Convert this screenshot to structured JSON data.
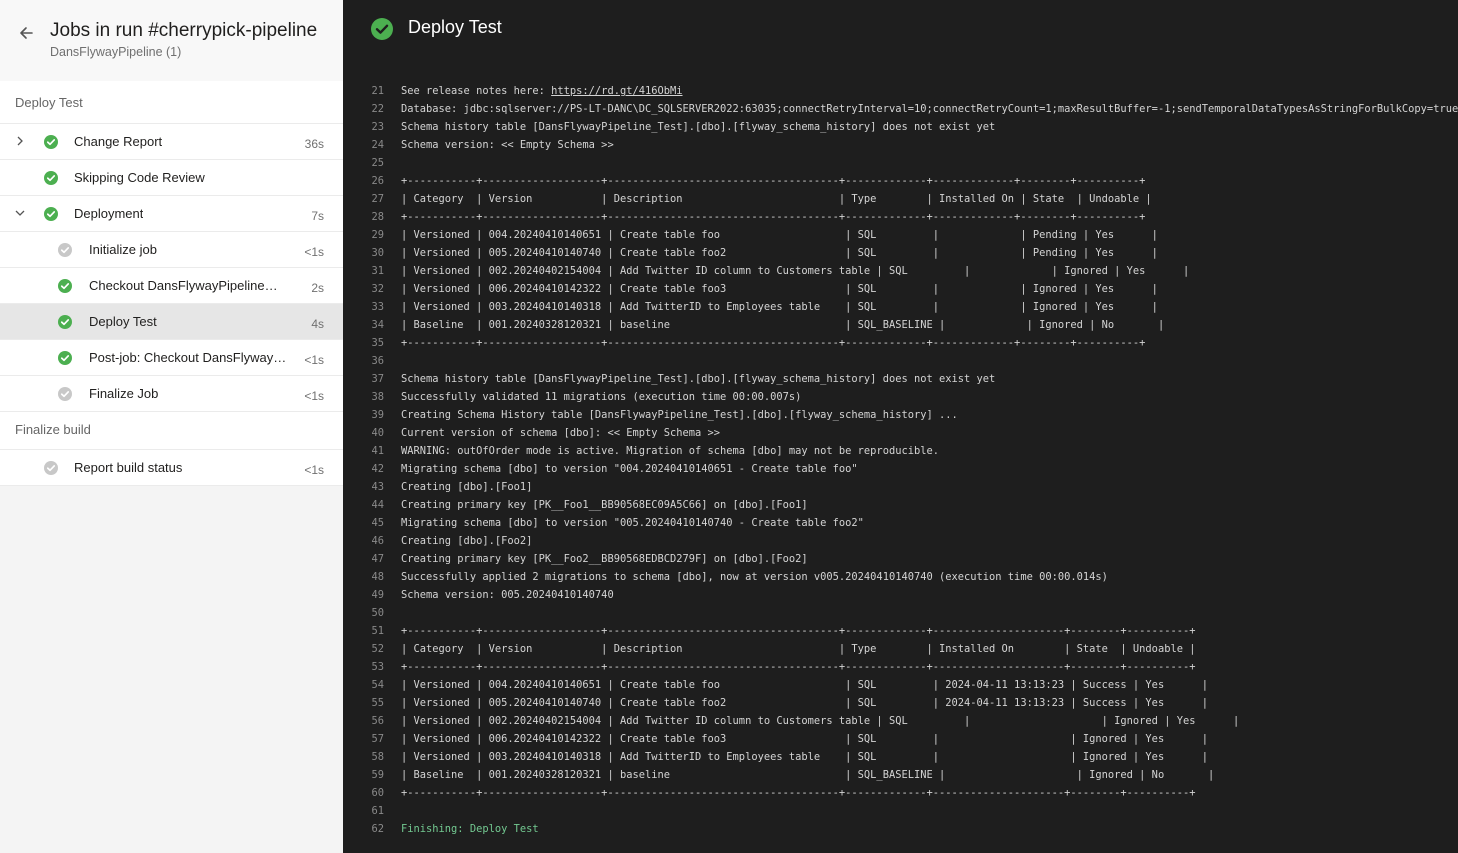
{
  "header": {
    "title": "Jobs in run #cherrypick-pipeline",
    "subtitle": "DansFlywayPipeline (1)"
  },
  "sections": [
    {
      "label": "Deploy Test"
    },
    {
      "label": "Finalize build"
    }
  ],
  "jobs": [
    {
      "label": "Change Report",
      "time": "36s"
    },
    {
      "label": "Skipping Code Review",
      "time": ""
    },
    {
      "label": "Deployment",
      "time": "7s"
    },
    {
      "label": "Initialize job",
      "time": "<1s"
    },
    {
      "label": "Checkout DansFlywayPipeline@main to s",
      "time": "2s"
    },
    {
      "label": "Deploy Test",
      "time": "4s"
    },
    {
      "label": "Post-job: Checkout DansFlywayPipeline@main to s",
      "time": "<1s"
    },
    {
      "label": "Finalize Job",
      "time": "<1s"
    },
    {
      "label": "Report build status",
      "time": "<1s"
    }
  ],
  "main": {
    "title": "Deploy Test",
    "link_text": "https://rd.gt/416ObMi",
    "lines": [
      {
        "n": "21",
        "t": "See release notes here: "
      },
      {
        "n": "22",
        "t": "Database: jdbc:sqlserver://PS-LT-DANC\\DC_SQLSERVER2022:63035;connectRetryInterval=10;connectRetryCount=1;maxResultBuffer=-1;sendTemporalDataTypesAsStringForBulkCopy=true;delayLoadingLobs=true;"
      },
      {
        "n": "23",
        "t": "Schema history table [DansFlywayPipeline_Test].[dbo].[flyway_schema_history] does not exist yet"
      },
      {
        "n": "24",
        "t": "Schema version: << Empty Schema >>"
      },
      {
        "n": "25",
        "t": ""
      },
      {
        "n": "26",
        "t": "+-----------+-------------------+-------------------------------------+-------------+-------------+--------+----------+"
      },
      {
        "n": "27",
        "t": "| Category  | Version           | Description                         | Type        | Installed On | State  | Undoable |"
      },
      {
        "n": "28",
        "t": "+-----------+-------------------+-------------------------------------+-------------+-------------+--------+----------+"
      },
      {
        "n": "29",
        "t": "| Versioned | 004.20240410140651 | Create table foo                    | SQL         |             | Pending | Yes      |"
      },
      {
        "n": "30",
        "t": "| Versioned | 005.20240410140740 | Create table foo2                   | SQL         |             | Pending | Yes      |"
      },
      {
        "n": "31",
        "t": "| Versioned | 002.20240402154004 | Add Twitter ID column to Customers table | SQL         |             | Ignored | Yes      |"
      },
      {
        "n": "32",
        "t": "| Versioned | 006.20240410142322 | Create table foo3                   | SQL         |             | Ignored | Yes      |"
      },
      {
        "n": "33",
        "t": "| Versioned | 003.20240410140318 | Add TwitterID to Employees table    | SQL         |             | Ignored | Yes      |"
      },
      {
        "n": "34",
        "t": "| Baseline  | 001.20240328120321 | baseline                            | SQL_BASELINE |             | Ignored | No       |"
      },
      {
        "n": "35",
        "t": "+-----------+-------------------+-------------------------------------+-------------+-------------+--------+----------+"
      },
      {
        "n": "36",
        "t": ""
      },
      {
        "n": "37",
        "t": "Schema history table [DansFlywayPipeline_Test].[dbo].[flyway_schema_history] does not exist yet"
      },
      {
        "n": "38",
        "t": "Successfully validated 11 migrations (execution time 00:00.007s)"
      },
      {
        "n": "39",
        "t": "Creating Schema History table [DansFlywayPipeline_Test].[dbo].[flyway_schema_history] ..."
      },
      {
        "n": "40",
        "t": "Current version of schema [dbo]: << Empty Schema >>"
      },
      {
        "n": "41",
        "t": "WARNING: outOfOrder mode is active. Migration of schema [dbo] may not be reproducible."
      },
      {
        "n": "42",
        "t": "Migrating schema [dbo] to version \"004.20240410140651 - Create table foo\""
      },
      {
        "n": "43",
        "t": "Creating [dbo].[Foo1]"
      },
      {
        "n": "44",
        "t": "Creating primary key [PK__Foo1__BB90568EC09A5C66] on [dbo].[Foo1]"
      },
      {
        "n": "45",
        "t": "Migrating schema [dbo] to version \"005.20240410140740 - Create table foo2\""
      },
      {
        "n": "46",
        "t": "Creating [dbo].[Foo2]"
      },
      {
        "n": "47",
        "t": "Creating primary key [PK__Foo2__BB90568EDBCD279F] on [dbo].[Foo2]"
      },
      {
        "n": "48",
        "t": "Successfully applied 2 migrations to schema [dbo], now at version v005.20240410140740 (execution time 00:00.014s)"
      },
      {
        "n": "49",
        "t": "Schema version: 005.20240410140740"
      },
      {
        "n": "50",
        "t": ""
      },
      {
        "n": "51",
        "t": "+-----------+-------------------+-------------------------------------+-------------+---------------------+--------+----------+"
      },
      {
        "n": "52",
        "t": "| Category  | Version           | Description                         | Type        | Installed On        | State  | Undoable |"
      },
      {
        "n": "53",
        "t": "+-----------+-------------------+-------------------------------------+-------------+---------------------+--------+----------+"
      },
      {
        "n": "54",
        "t": "| Versioned | 004.20240410140651 | Create table foo                    | SQL         | 2024-04-11 13:13:23 | Success | Yes      |"
      },
      {
        "n": "55",
        "t": "| Versioned | 005.20240410140740 | Create table foo2                   | SQL         | 2024-04-11 13:13:23 | Success | Yes      |"
      },
      {
        "n": "56",
        "t": "| Versioned | 002.20240402154004 | Add Twitter ID column to Customers table | SQL         |                     | Ignored | Yes      |"
      },
      {
        "n": "57",
        "t": "| Versioned | 006.20240410142322 | Create table foo3                   | SQL         |                     | Ignored | Yes      |"
      },
      {
        "n": "58",
        "t": "| Versioned | 003.20240410140318 | Add TwitterID to Employees table    | SQL         |                     | Ignored | Yes      |"
      },
      {
        "n": "59",
        "t": "| Baseline  | 001.20240328120321 | baseline                            | SQL_BASELINE |                     | Ignored | No       |"
      },
      {
        "n": "60",
        "t": "+-----------+-------------------+-------------------------------------+-------------+---------------------+--------+----------+"
      },
      {
        "n": "61",
        "t": ""
      },
      {
        "n": "62",
        "t": "Finishing: Deploy Test"
      }
    ]
  },
  "colors": {
    "success": "#4caf50",
    "skipped": "#c8c8c8",
    "log_bg": "#1e1e1e"
  }
}
